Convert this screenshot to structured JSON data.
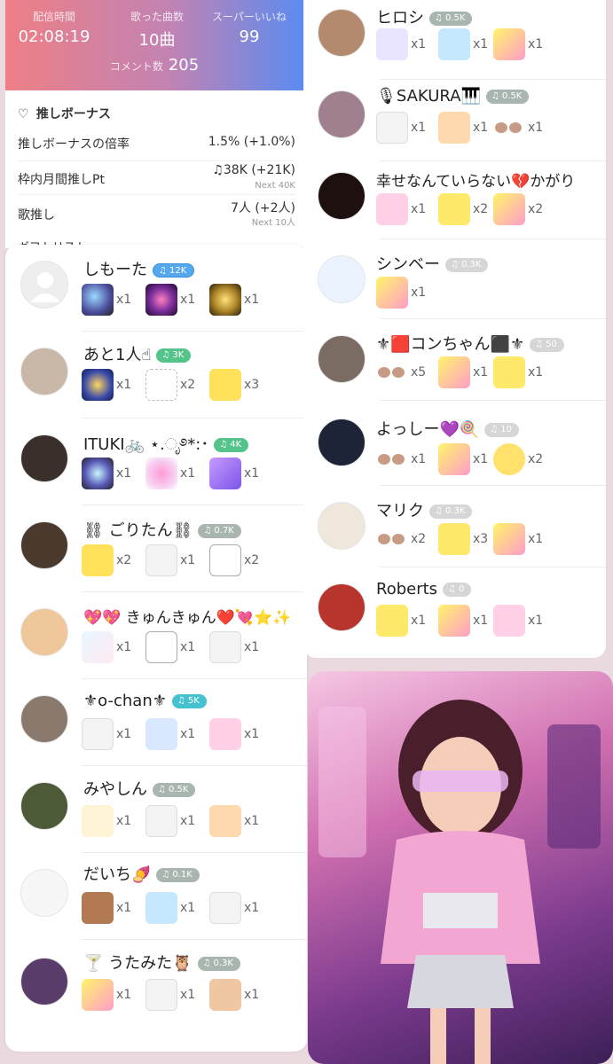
{
  "stats": {
    "duration_label": "配信時間",
    "duration": "02:08:19",
    "songs_label": "歌った曲数",
    "songs": "10曲",
    "likes_label": "スーパーいいね",
    "likes": "99",
    "comments_label": "コメント数",
    "comments": "205"
  },
  "bonus": {
    "title": "推しボーナス",
    "rate_label": "推しボーナスの倍率",
    "rate_value": "1.5% (+1.0%)",
    "pt_label": "枠内月間推しPt",
    "pt_value": "♫38K (+21K)",
    "pt_next": "Next 40K",
    "fans_label": "歌推し",
    "fans_value": "7人 (+2人)",
    "fans_next": "Next 10人",
    "cut_text": "ギフトリスト"
  },
  "left_users": [
    {
      "name": "しもーた",
      "badge": "12K",
      "gifts": [
        "x1",
        "x1",
        "x1"
      ]
    },
    {
      "name": "あと1人☝",
      "badge": "3K",
      "gifts": [
        "x1",
        "x2",
        "x3"
      ]
    },
    {
      "name": "ITUKI🚲 ⋆.ೃ࿔*:･",
      "badge": "4K",
      "gifts": [
        "x1",
        "x1",
        "x1"
      ]
    },
    {
      "name": "⛓ ごりたん⛓",
      "badge": "0.7K",
      "gifts": [
        "x2",
        "x1",
        "x2"
      ]
    },
    {
      "name": "💖💖 きゅんきゅん❤️💘⭐✨",
      "badge": "",
      "gifts": [
        "x1",
        "x1",
        "x1"
      ]
    },
    {
      "name": "⚜o-chan⚜",
      "badge": "5K",
      "gifts": [
        "x1",
        "x1",
        "x1"
      ]
    },
    {
      "name": "みやしん",
      "badge": "0.5K",
      "gifts": [
        "x1",
        "x1",
        "x1"
      ]
    },
    {
      "name": "だいち🍠",
      "badge": "0.1K",
      "gifts": [
        "x1",
        "x1",
        "x1"
      ]
    },
    {
      "name": "🍸 うたみた🦉",
      "badge": "0.3K",
      "gifts": [
        "x1",
        "x1",
        "x1"
      ]
    }
  ],
  "right_users": [
    {
      "name": "ヒロシ",
      "badge": "0.5K",
      "gifts": [
        "x1",
        "x1",
        "x1"
      ]
    },
    {
      "name": "🎙SAKURA🎹",
      "badge": "0.5K",
      "gifts": [
        "x1",
        "x1",
        "x1"
      ]
    },
    {
      "name": "幸せなんていらない💔かがり",
      "badge": "",
      "gifts": [
        "x1",
        "x2",
        "x2"
      ]
    },
    {
      "name": "シンベー",
      "badge": "0.3K",
      "gifts": [
        "x1"
      ]
    },
    {
      "name": "⚜🟥コンちゃん⬛⚜",
      "badge": "50",
      "gifts": [
        "x5",
        "x1",
        "x1"
      ]
    },
    {
      "name": "よっしー💜🍭",
      "badge": "10",
      "gifts": [
        "x1",
        "x1",
        "x2"
      ]
    },
    {
      "name": "マリク",
      "badge": "0.3K",
      "gifts": [
        "x2",
        "x3",
        "x1"
      ]
    },
    {
      "name": "Roberts",
      "badge": "0",
      "gifts": [
        "x1",
        "x1",
        "x1"
      ]
    }
  ]
}
